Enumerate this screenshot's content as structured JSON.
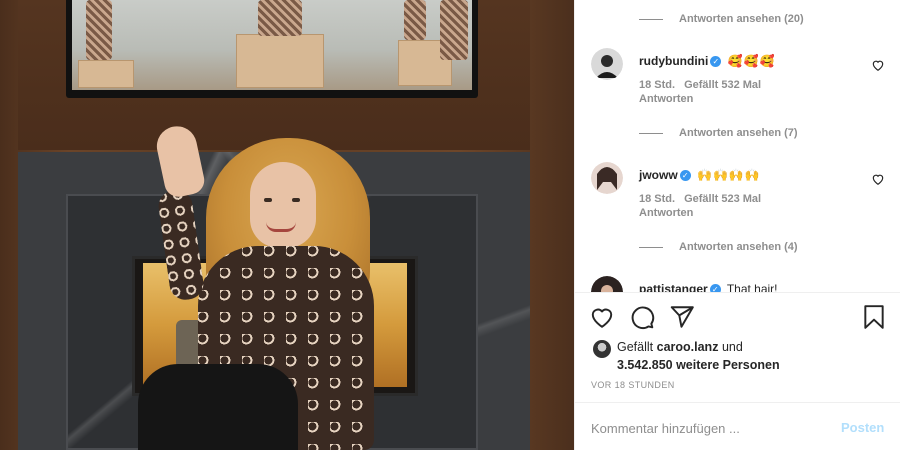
{
  "comments": {
    "thread": [
      {
        "type": "view-replies",
        "label": "Antworten ansehen (20)"
      },
      {
        "type": "comment",
        "username": "rudybundini",
        "text": "🥰🥰🥰",
        "time": "18 Std.",
        "likes": "Gefällt 532 Mal",
        "reply": "Antworten"
      },
      {
        "type": "view-replies",
        "label": "Antworten ansehen (7)"
      },
      {
        "type": "comment",
        "username": "jwoww",
        "text": "🙌🙌🙌🙌",
        "time": "18 Std.",
        "likes": "Gefällt 523 Mal",
        "reply": "Antworten"
      },
      {
        "type": "view-replies",
        "label": "Antworten ansehen (4)"
      },
      {
        "type": "comment-partial",
        "username": "pattistanger",
        "text": "That hair!"
      }
    ]
  },
  "actions": {
    "icons": [
      "heart-icon",
      "comment-icon",
      "share-icon",
      "bookmark-icon"
    ]
  },
  "likes": {
    "prefix": "Gefällt",
    "user": "caroo.lanz",
    "connector": "und",
    "others": "3.542.850 weitere Personen"
  },
  "timestamp": "VOR 18 STUNDEN",
  "comment_box": {
    "placeholder": "Kommentar hinzufügen ...",
    "post_label": "Posten"
  },
  "colors": {
    "verified": "#3897f0",
    "post_disabled": "#b2dffc",
    "muted_text": "#8e8e8e"
  }
}
